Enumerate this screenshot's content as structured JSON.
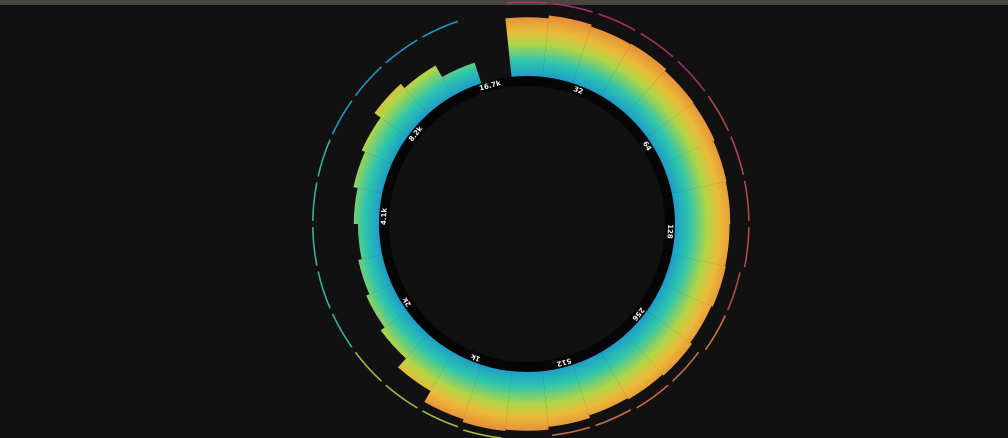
{
  "chart_data": {
    "type": "radial-bar",
    "title": "",
    "angle_range_deg": [
      -75,
      290
    ],
    "radial_range": [
      0,
      1
    ],
    "tick_labels": [
      "16.7k",
      "32",
      "64",
      "128",
      "256",
      "512",
      "1k",
      "2k",
      "4.1k",
      "8.2k"
    ],
    "bars": [
      {
        "angle": 0,
        "value": 0.84
      },
      {
        "angle": 12,
        "value": 0.88
      },
      {
        "angle": 24,
        "value": 0.85
      },
      {
        "angle": 36,
        "value": 0.86
      },
      {
        "angle": 48,
        "value": 0.83
      },
      {
        "angle": 60,
        "value": 0.82
      },
      {
        "angle": 72,
        "value": 0.8
      },
      {
        "angle": 84,
        "value": 0.79
      },
      {
        "angle": 96,
        "value": 0.78
      },
      {
        "angle": 108,
        "value": 0.79
      },
      {
        "angle": 120,
        "value": 0.77
      },
      {
        "angle": 132,
        "value": 0.8
      },
      {
        "angle": 144,
        "value": 0.78
      },
      {
        "angle": 156,
        "value": 0.76
      },
      {
        "angle": 168,
        "value": 0.8
      },
      {
        "angle": 180,
        "value": 0.84
      },
      {
        "angle": 192,
        "value": 0.86
      },
      {
        "angle": 204,
        "value": 0.82
      },
      {
        "angle": 216,
        "value": 0.64
      },
      {
        "angle": 228,
        "value": 0.47
      },
      {
        "angle": 240,
        "value": 0.4
      },
      {
        "angle": 252,
        "value": 0.35
      },
      {
        "angle": 264,
        "value": 0.3
      },
      {
        "angle": 276,
        "value": 0.36
      },
      {
        "angle": 288,
        "value": 0.42
      },
      {
        "angle": 300,
        "value": 0.47
      },
      {
        "angle": 312,
        "value": 0.58
      },
      {
        "angle": 324,
        "value": 0.5
      },
      {
        "angle": 336,
        "value": 0.31
      }
    ],
    "peak_outline": [
      {
        "angle": 0,
        "value": 0.97
      },
      {
        "angle": 12,
        "value": 0.97
      },
      {
        "angle": 24,
        "value": 0.97
      },
      {
        "angle": 36,
        "value": 0.97
      },
      {
        "angle": 48,
        "value": 0.97
      },
      {
        "angle": 60,
        "value": 0.97
      },
      {
        "angle": 72,
        "value": 0.97
      },
      {
        "angle": 84,
        "value": 0.97
      },
      {
        "angle": 96,
        "value": 0.97
      },
      {
        "angle": 108,
        "value": 0.92
      },
      {
        "angle": 120,
        "value": 0.92
      },
      {
        "angle": 132,
        "value": 0.86
      },
      {
        "angle": 144,
        "value": 0.86
      },
      {
        "angle": 156,
        "value": 0.84
      },
      {
        "angle": 168,
        "value": 0.84
      },
      {
        "angle": 180,
        "value": 0.88
      },
      {
        "angle": 192,
        "value": 0.88
      },
      {
        "angle": 204,
        "value": 0.86
      },
      {
        "angle": 216,
        "value": 0.86
      },
      {
        "angle": 228,
        "value": 0.86
      },
      {
        "angle": 240,
        "value": 0.86
      },
      {
        "angle": 252,
        "value": 0.86
      },
      {
        "angle": 264,
        "value": 0.86
      },
      {
        "angle": 276,
        "value": 0.86
      },
      {
        "angle": 288,
        "value": 0.86
      },
      {
        "angle": 300,
        "value": 0.86
      },
      {
        "angle": 312,
        "value": 0.86
      },
      {
        "angle": 324,
        "value": 0.86
      },
      {
        "angle": 336,
        "value": 0.86
      }
    ],
    "gradient_colors": [
      "#6a3fb0",
      "#1b9ed8",
      "#2fcfb4",
      "#b8e04a",
      "#f7c23a",
      "#f08a3a"
    ],
    "outline_colors": [
      "#b2306f",
      "#c05050",
      "#e07a3a",
      "#b8d040",
      "#38c0b0",
      "#1aa8d8"
    ],
    "background": "#111111",
    "ring_color": "#050505"
  }
}
